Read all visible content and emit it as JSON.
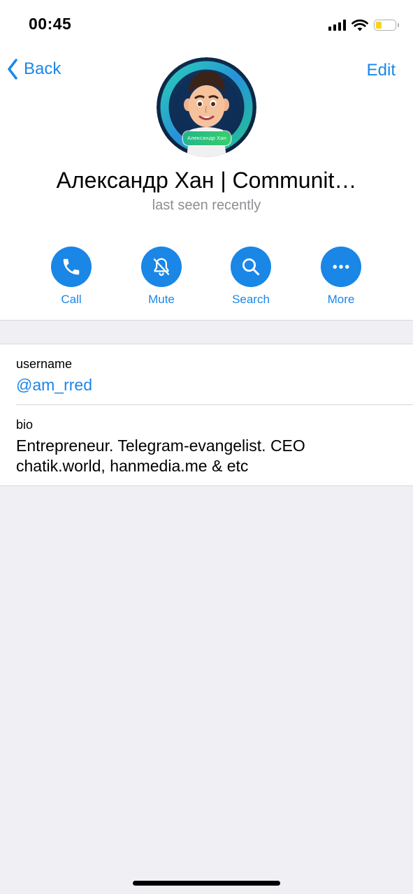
{
  "status_bar": {
    "time": "00:45",
    "icons": [
      "signal-icon",
      "wifi-icon",
      "battery-icon"
    ],
    "battery_color": "#f7d31a"
  },
  "nav": {
    "back_label": "Back",
    "edit_label": "Edit"
  },
  "profile": {
    "avatar_label": "Александр Хан",
    "name": "Александр Хан | Communit…",
    "status": "last seen recently"
  },
  "actions": [
    {
      "label": "Call",
      "icon": "phone-icon"
    },
    {
      "label": "Mute",
      "icon": "bell-slash-icon"
    },
    {
      "label": "Search",
      "icon": "search-icon"
    },
    {
      "label": "More",
      "icon": "more-icon"
    }
  ],
  "info": {
    "username_label": "username",
    "username_value": "@am_rred",
    "bio_label": "bio",
    "bio_line1": "Entrepreneur. Telegram-evangelist. CEO",
    "bio_line2": "chatik.world, hanmedia.me & etc"
  },
  "colors": {
    "accent": "#1c86e8",
    "secondary_text": "#8e8e93",
    "background": "#efeff4"
  }
}
